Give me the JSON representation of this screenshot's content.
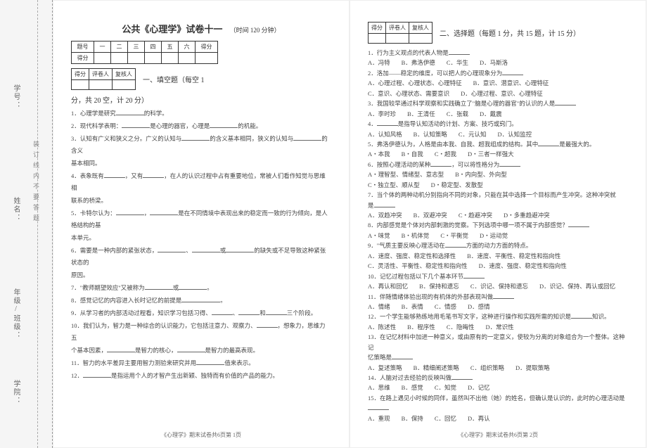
{
  "margin": {
    "labels": {
      "college": "学院：",
      "class": "年级/班级：",
      "name": "姓名：",
      "id": "学号："
    },
    "line_text": "装订线内不要答题"
  },
  "header": {
    "main_title": "公共《心理学》试卷十一",
    "sub_title": "（时间 120 分钟）",
    "th_num": "题号",
    "th1": "一",
    "th2": "二",
    "th3": "三",
    "th4": "四",
    "th5": "五",
    "th6": "六",
    "th_score": "得分",
    "score_row": "得分",
    "grade": "得分",
    "grader": "评卷人",
    "reviewer": "复核人"
  },
  "sec1": {
    "title_a": "一、填空题（每空 1",
    "title_b": "分，共 20 空，计 20 分）"
  },
  "fill": {
    "q1": "1．心理学是研究",
    "q1b": "的科学。",
    "q2": "2．现代科学表明：",
    "q2b": "是心理的器官，心理是",
    "q2c": "的机能。",
    "q3": "3．认知有广义和狭义之分。广义的认知与",
    "q3b": "的含义基本相同，狭义的认知与",
    "q3c": "的含义",
    "q3d": "基本相同。",
    "q4": "4．表象既有",
    "q4b": "，又有",
    "q4c": "，在人的认识过程中占有重要地位，常被人们看作知觉与思维相",
    "q4d": "联系的桥梁。",
    "q5": "5．卡特尔认为：",
    "q5b": "，",
    "q5c": "是在不同情境中表现出来的稳定而一致的行为倾向，是人格结构的基",
    "q5d": "本单元。",
    "q6": "6．需要是一种内部的紧张状态，",
    "q6b": "、",
    "q6c": "或",
    "q6d": "的缺失或不足导致这种紧张状态的",
    "q6e": "原因。",
    "q7": "7．\"教师期望效应\"又被称为",
    "q7b": "或",
    "q7c": "。",
    "q8": "8．感觉记忆的内容进入长时记忆的前提是",
    "q8b": "。",
    "q9": "9．从学习者的内部活动过程看，知识学习包括习得、",
    "q9b": "、",
    "q9c": "和",
    "q9d": "三个阶段。",
    "q10": "10．我们认为，智力是一种综合的认识能力，它包括注意力、观察力、",
    "q10b": "，想象力，思维力五",
    "q10c": "个基本因素，",
    "q10d": "是智力的核心，",
    "q10e": "是智力的最高表现。",
    "q11": "11．智力的水平差异主要用智力测验来研究并用",
    "q11b": "值来表示。",
    "q12": "12．",
    "q12b": "是指运用个人的才智产生出新颖、独特而有价值的产品的能力。"
  },
  "sec2": {
    "title": "二、选择题（每题 1 分，共 15 题，计 15 分）"
  },
  "choice": {
    "q1": "1．行为主义观点的代表人物是",
    "q1o": {
      "a": "A．冯特",
      "b": "B．弗洛伊德",
      "c": "C．华生",
      "d": "D．马斯洛"
    },
    "q2": "2．洛加——稳定的维度，可以把人的心理现象分为",
    "q2o": {
      "a": "A．心理过程、心理状态、心理特征",
      "b": "B．意识、潜意识、心理特征",
      "c": "C．意识、心理状态、需要意识",
      "d": "D．心理过程、意识、心理特征"
    },
    "q3": "3．我国较早通过科学观察和实践确立了\"脑是心理的器官\"的认识的人是",
    "q3o": {
      "a": "A．李时珍",
      "b": "B．王清任",
      "c": "C．张载",
      "d": "D．戴震"
    },
    "q4": "4．",
    "q4b": "是指导认知活动的计划、方案、技巧或窍门。",
    "q4o": {
      "a": "A．认知风格",
      "b": "B．认知策略",
      "c": "C．元认知",
      "d": "D．认知监控"
    },
    "q5": "5．弗洛伊德认为，人格是由本我、自我、超我组成的结构。其中",
    "q5b": "是最强大的。",
    "q5o": {
      "a": "A・本我",
      "b": "B・自我",
      "c": "C・超我",
      "d": "D・三者一样强大"
    },
    "q6": "6．按照心理活动的某种",
    "q6b": "，可以将性格分为",
    "q6o": {
      "a": "A・理智型、情绪型、意志型",
      "b": "B・内向型、外向型",
      "c": "C・独立型、顺从型",
      "d": "D・稳定型、发散型"
    },
    "q7": "7．当个体的两种动机分别指向不同的对象，只能在其中选择一个目标而产生冲突。这种冲突就",
    "q7b": "是",
    "q7o": {
      "a": "A．双趋冲突",
      "b": "B．双避冲突",
      "c": "C・趋避冲突",
      "d": "D・多重趋避冲突"
    },
    "q8": "8．内部感觉是个体对内部刺激的觉察。下列选项中哪一项不属于内部感觉？",
    "q8o": {
      "a": "A・味觉",
      "b": "B・机体觉",
      "c": "C・平衡觉",
      "d": "D・运动觉"
    },
    "q9": "9．\"气质主要反映心理活动在",
    "q9b": "方面的动力方面的特点。",
    "q9o": {
      "a": "A．速度、强度、稳定性和选择性",
      "b": "B．速度、平衡性、稳定性和指向性",
      "c": "C．灵活性、平衡性、稳定性和指向性",
      "d": "D．速度、强度、稳定性和指向性"
    },
    "q10": "10．记忆过程包括以下几个基本环节",
    "q10o": {
      "a": "A．再认和回忆",
      "b": "B．保持和遗忘",
      "c": "C．识记、保持和遗忘",
      "d": "D．识记、保持、再认或回忆"
    },
    "q11": "11．伴随情绪体验出现的有机体的外部表现叫做",
    "q11o": {
      "a": "A．情绪",
      "b": "B．表情",
      "c": "C．情感",
      "d": "D．感情"
    },
    "q12": "12．一个学生能够熟练地用毛笔书写文字，这种进行操作和实践所需的知识是",
    "q12b": "知识。",
    "q12o": {
      "a": "A．陈述性",
      "b": "B．程序性",
      "c": "C．隐晦性",
      "d": "D．常识性"
    },
    "q13": "13．在记忆材料中加进一种意义，或由原有的一定意义，使较为分离的对象组合为一个整体。这种记",
    "q13b": "忆策略是",
    "q13o": {
      "a": "A．复述策略",
      "b": "B．精细阐述策略",
      "c": "C．组织策略",
      "d": "D．提取策略"
    },
    "q14": "14．人脑对过去经验的反映叫做",
    "q14o": {
      "a": "A．思维",
      "b": "B．感觉",
      "c": "C．知觉",
      "d": "D．记忆"
    },
    "q15": "15．在路上遇见小时候的同伴，虽然叫不出他（她）的姓名，但确认是认识的，此时的心理活动是",
    "q15o": {
      "a": "A．重现",
      "b": "B．保持",
      "c": "C．回忆",
      "d": "D．再认"
    }
  },
  "footer": {
    "left": "《心理学》期末试卷共6页第 1页",
    "right": "《心理学》期末试卷共6页第 2页"
  }
}
